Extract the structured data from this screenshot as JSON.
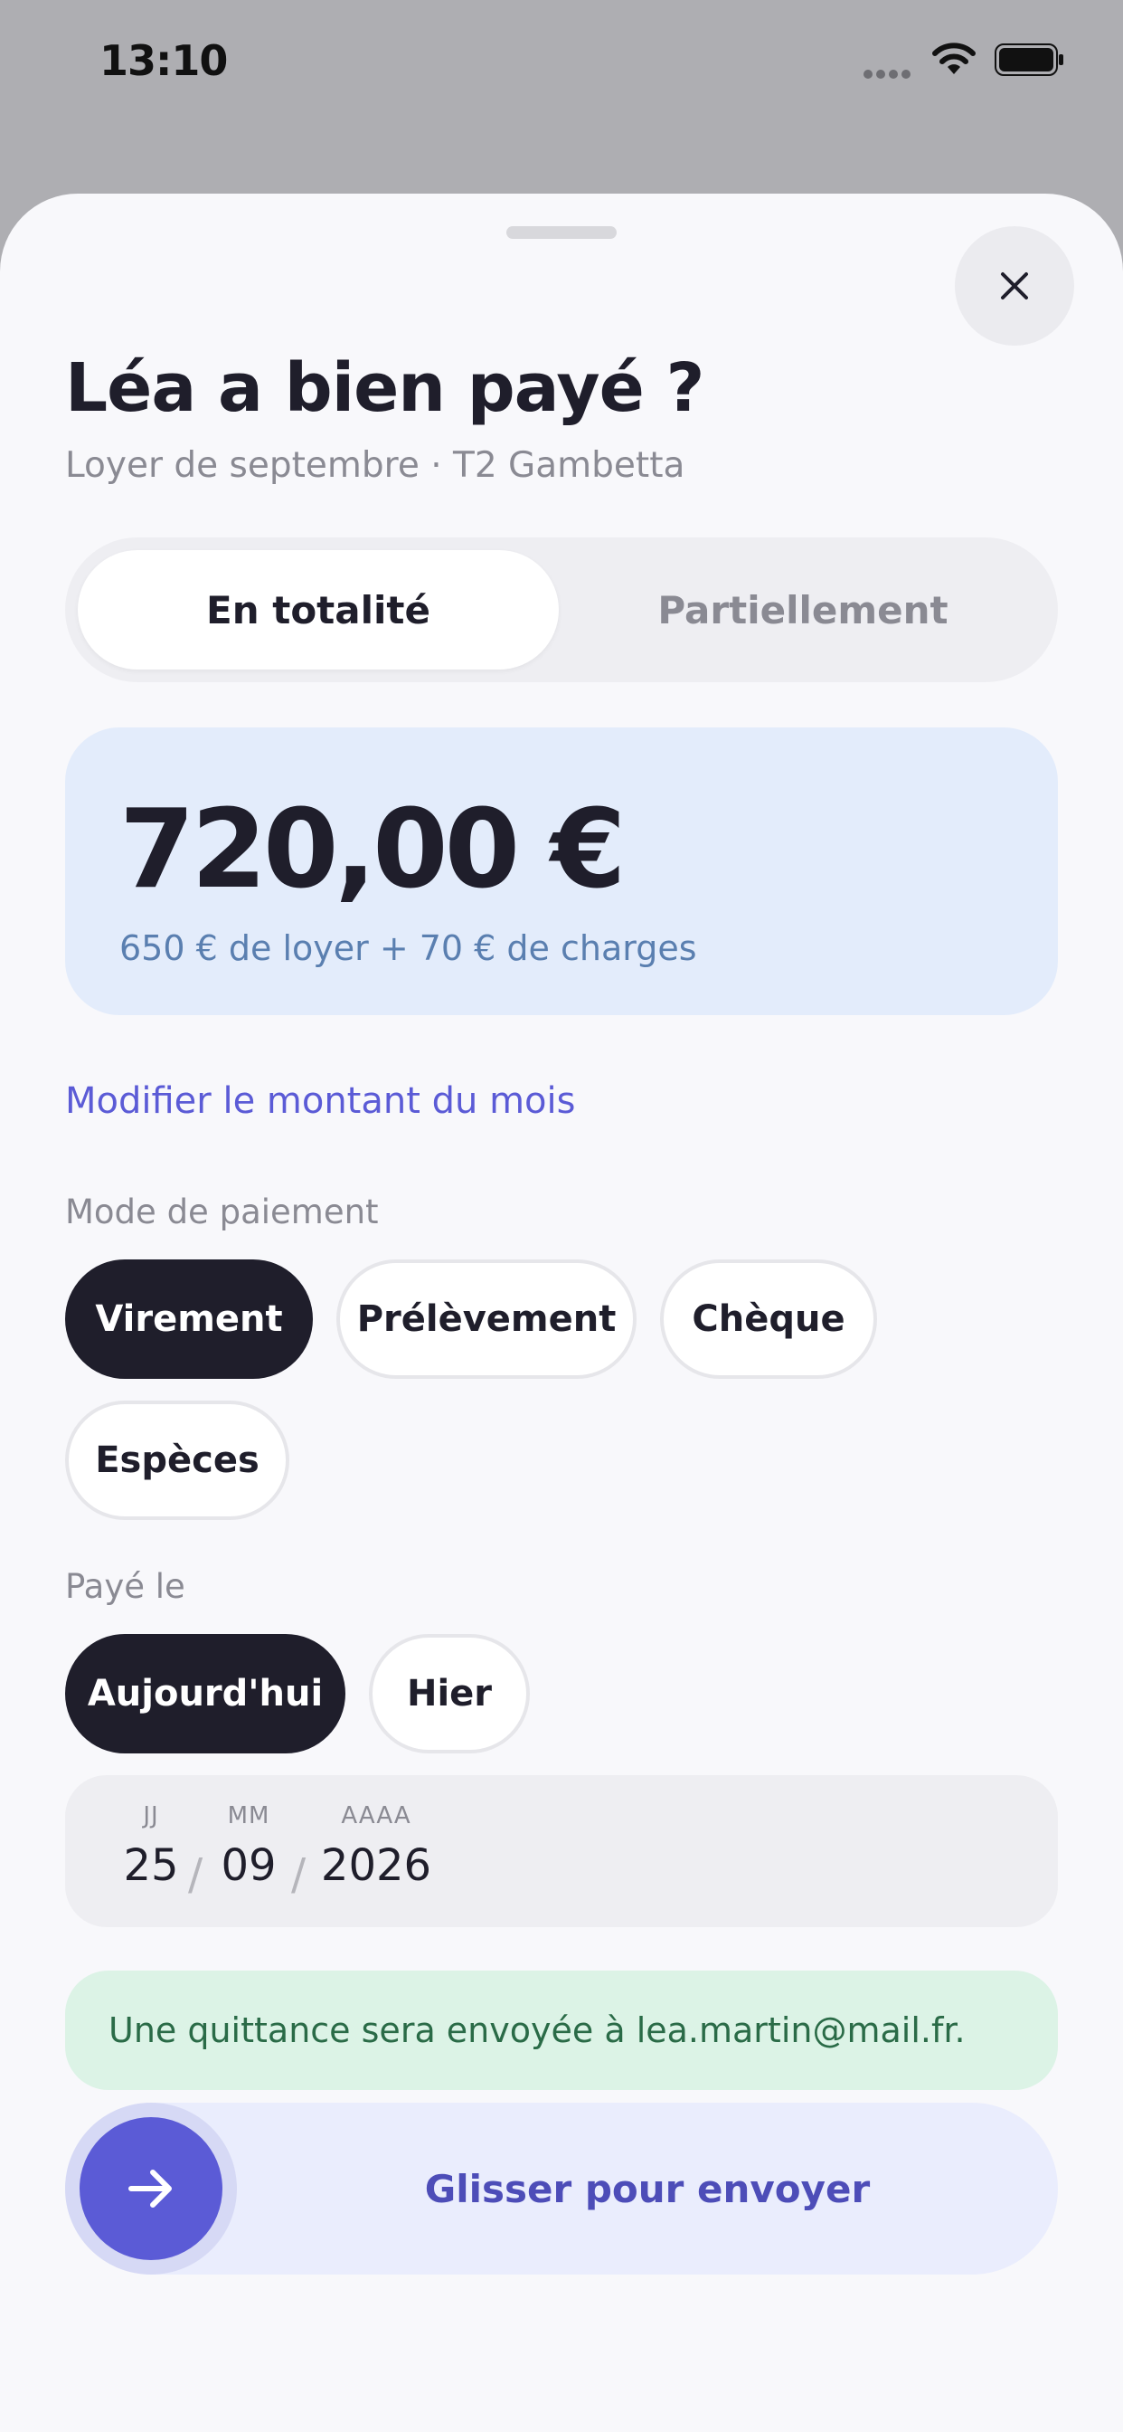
{
  "status_bar": {
    "time": "13:10"
  },
  "sheet": {
    "title": "Léa a bien payé ?",
    "subtitle": "Loyer de septembre · T2 Gambetta",
    "close_icon": "close-icon"
  },
  "segmented": {
    "options": [
      "En totalité",
      "Partiellement"
    ],
    "selected": "En totalité"
  },
  "amount": {
    "value": "720,00 €",
    "breakdown": "650 € de loyer + 70 € de charges"
  },
  "modify_link": "Modifier le montant du mois",
  "payment_mode": {
    "label": "Mode de paiement",
    "options": [
      "Virement",
      "Prélèvement",
      "Chèque",
      "Espèces"
    ],
    "selected": "Virement"
  },
  "paid_on": {
    "label": "Payé le",
    "options": [
      "Aujourd'hui",
      "Hier"
    ],
    "selected": "Aujourd'hui"
  },
  "date": {
    "day_label": "JJ",
    "day": "25",
    "month_label": "MM",
    "month": "09",
    "year_label": "AAAA",
    "year": "2026",
    "separator": "/"
  },
  "info_banner": "Une quittance sera envoyée à lea.martin@mail.fr.",
  "slider": {
    "label": "Glisser pour envoyer",
    "knob_icon": "arrow-right-icon"
  },
  "colors": {
    "accent": "#5b5bd6",
    "dark": "#1f1e2b",
    "amount_card": "#e3ecfb",
    "success_bg": "#dcf3e6"
  }
}
